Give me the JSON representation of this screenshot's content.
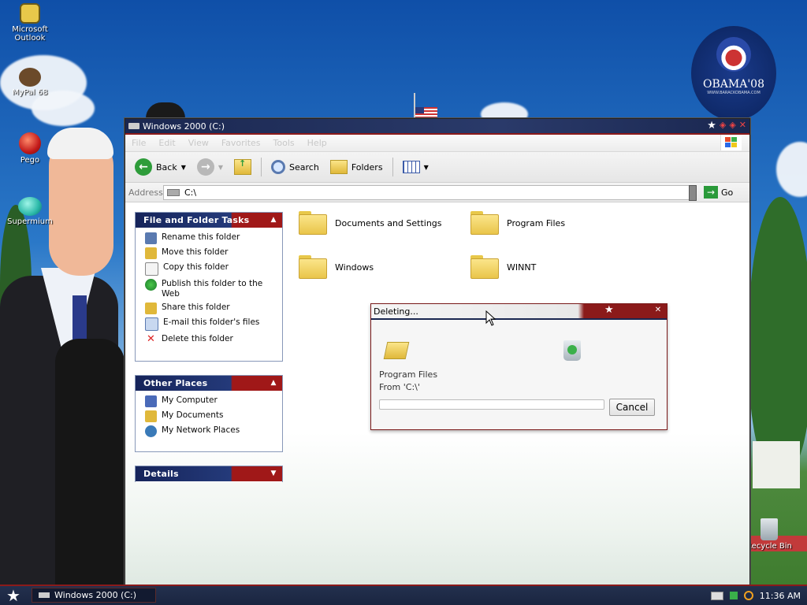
{
  "desktop": {
    "icons": [
      {
        "label": "Microsoft Outlook",
        "icon": "outlook-icon"
      },
      {
        "label": "MyPal 68",
        "icon": "mypal-icon"
      },
      {
        "label": "Pego",
        "icon": "pego-icon"
      },
      {
        "label": "Supermium",
        "icon": "supermium-icon"
      },
      {
        "label": "Recycle Bin",
        "icon": "recycle-bin-icon"
      }
    ],
    "badge": {
      "main": "OBAMA'08",
      "sub": "WWW.BARACKOBAMA.COM"
    }
  },
  "window": {
    "title": "Windows 2000 (C:)",
    "menu": [
      "File",
      "Edit",
      "View",
      "Favorites",
      "Tools",
      "Help"
    ],
    "toolbar": {
      "back": "Back",
      "search": "Search",
      "folders": "Folders"
    },
    "address": {
      "label": "Address",
      "value": "C:\\",
      "go": "Go"
    },
    "panels": {
      "file_tasks": {
        "title": "File and Folder Tasks",
        "items": [
          "Rename this folder",
          "Move this folder",
          "Copy this folder",
          "Publish this folder to the Web",
          "Share this folder",
          "E-mail this folder's files",
          "Delete this folder"
        ]
      },
      "other_places": {
        "title": "Other Places",
        "items": [
          "My Computer",
          "My Documents",
          "My Network Places"
        ]
      },
      "details": {
        "title": "Details"
      }
    },
    "folders": [
      "Documents and Settings",
      "Program Files",
      "Windows",
      "WINNT"
    ]
  },
  "dialog": {
    "title": "Deleting...",
    "item_name": "Program Files",
    "item_from": "From 'C:\\'",
    "progress": 0,
    "cancel": "Cancel"
  },
  "taskbar": {
    "task": "Windows 2000 (C:)",
    "clock": "11:36 AM"
  },
  "colors": {
    "navy": "#1a2750",
    "red": "#8b1a1a",
    "green": "#2a9a3a"
  }
}
